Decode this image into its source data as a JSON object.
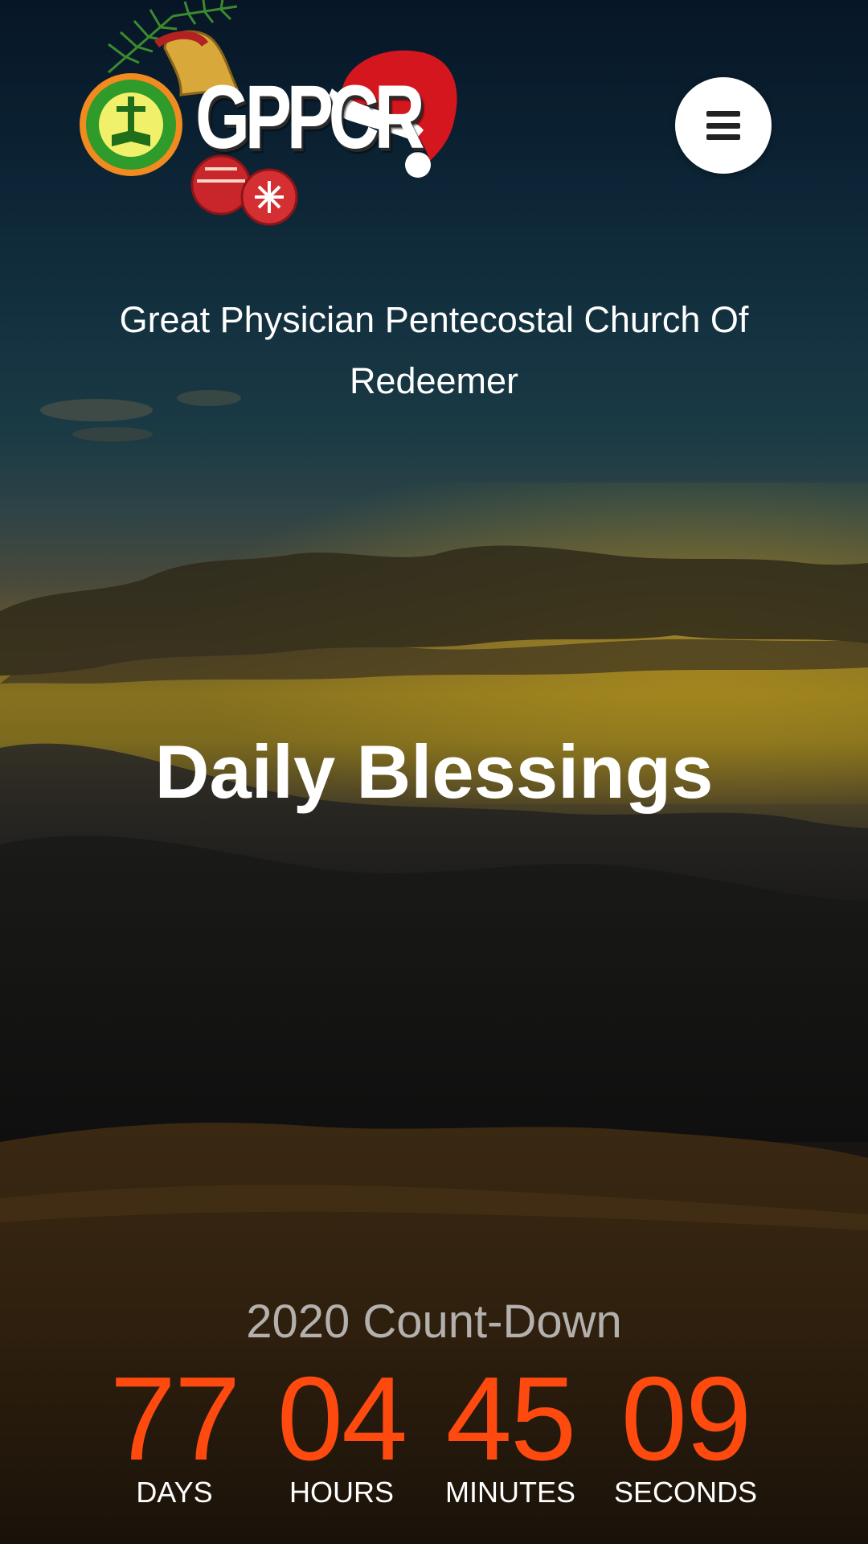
{
  "header": {
    "logo_text": "GPPCR",
    "logo_emblem_alt": "church-emblem",
    "menu_icon": "hamburger-menu-icon"
  },
  "church": {
    "name": "Great Physician Pentecostal Church Of Redeemer"
  },
  "hero": {
    "title": "Daily Blessings"
  },
  "countdown": {
    "title": "2020 Count-Down",
    "units": [
      {
        "value": "77",
        "label": "DAYS"
      },
      {
        "value": "04",
        "label": "HOURS"
      },
      {
        "value": "45",
        "label": "MINUTES"
      },
      {
        "value": "09",
        "label": "SECONDS"
      }
    ]
  },
  "colors": {
    "accent": "#ff4a0f",
    "countdown_title": "#b4b0ad",
    "text": "#ffffff"
  }
}
